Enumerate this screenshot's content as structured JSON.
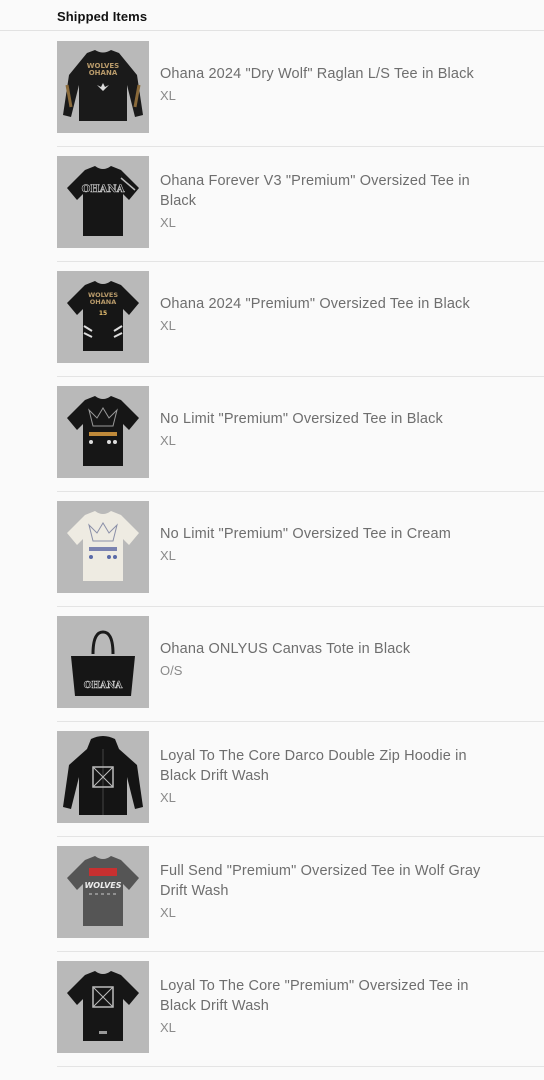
{
  "header": {
    "title": "Shipped Items"
  },
  "items": [
    {
      "name": "Ohana 2024 \"Dry Wolf\" Raglan L/S Tee in Black",
      "variant": "XL",
      "icon": "longsleeve-black-icon"
    },
    {
      "name": "Ohana Forever V3 \"Premium\" Oversized Tee in Black",
      "variant": "XL",
      "icon": "tee-black-icon"
    },
    {
      "name": "Ohana 2024 \"Premium\" Oversized Tee in Black",
      "variant": "XL",
      "icon": "tee-black-icon"
    },
    {
      "name": "No Limit \"Premium\" Oversized Tee in Black",
      "variant": "XL",
      "icon": "tee-black-icon"
    },
    {
      "name": "No Limit \"Premium\" Oversized Tee in Cream",
      "variant": "XL",
      "icon": "tee-cream-icon"
    },
    {
      "name": "Ohana ONLYUS Canvas Tote in Black",
      "variant": "O/S",
      "icon": "tote-bag-icon"
    },
    {
      "name": "Loyal To The Core Darco Double Zip Hoodie in Black Drift Wash",
      "variant": "XL",
      "icon": "hoodie-black-icon"
    },
    {
      "name": "Full Send \"Premium\" Oversized Tee in Wolf Gray Drift Wash",
      "variant": "XL",
      "icon": "tee-gray-icon"
    },
    {
      "name": "Loyal To The Core \"Premium\" Oversized Tee in Black Drift Wash",
      "variant": "XL",
      "icon": "tee-black-icon"
    }
  ]
}
